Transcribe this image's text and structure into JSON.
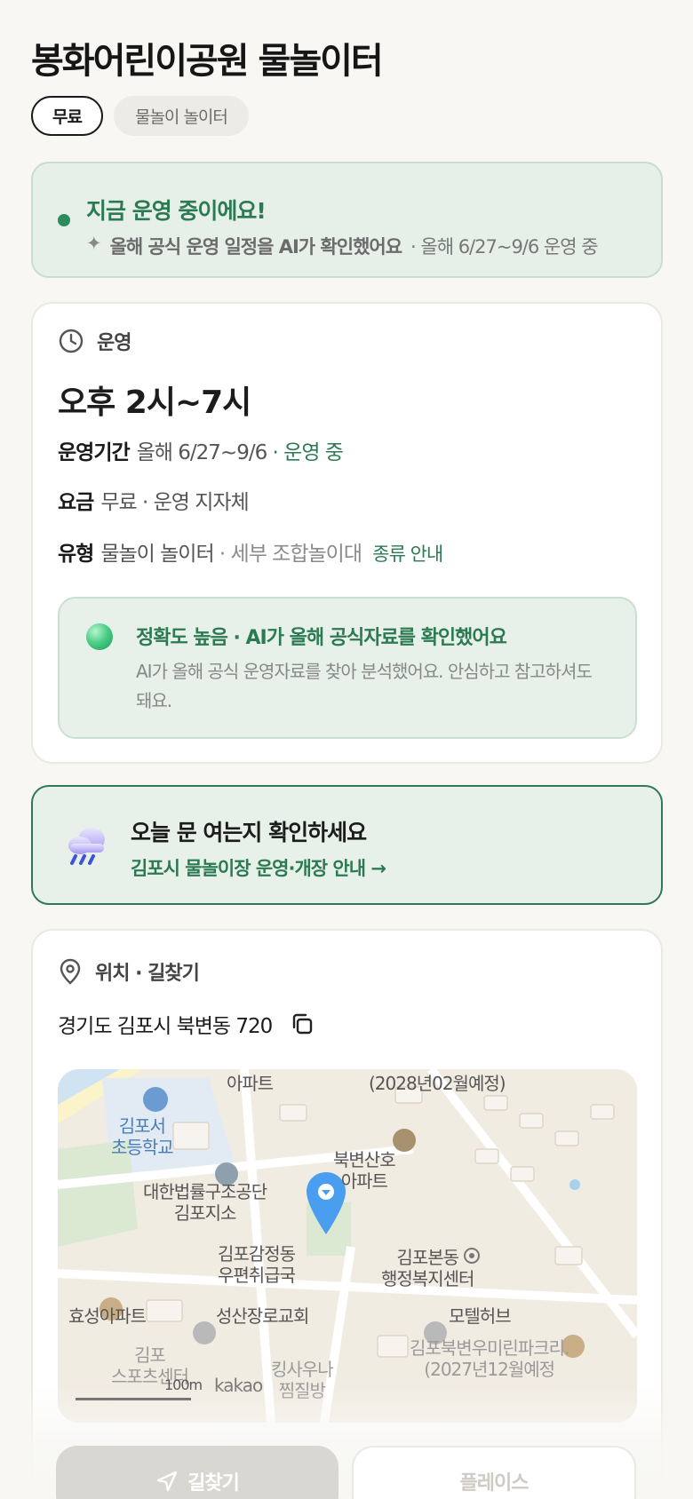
{
  "header": {
    "title": "봉화어린이공원 물놀이터",
    "chips": [
      "무료",
      "물놀이 놀이터"
    ]
  },
  "status": {
    "title": "지금 운영 중이에요!",
    "ai_note": "올해 공식 운영 일정을 AI가 확인했어요",
    "period": "· 올해 6/27~9/6 운영 중"
  },
  "operation": {
    "section_label": "운영",
    "hours": "오후 2시~7시",
    "period_label": "운영기간",
    "period_value": "올해 6/27~9/6",
    "period_status": "· 운영 중",
    "fee_label": "요금",
    "fee_value": "무료 · 운영 지자체",
    "type_label": "유형",
    "type_value": "물놀이 놀이터",
    "type_detail": "· 세부 조합놀이대",
    "type_link": "종류 안내",
    "accuracy": {
      "title": "정확도 높음 · AI가 올해 공식자료를 확인했어요",
      "description": "AI가 올해 공식 운영자료를 찾아 분석했어요. 안심하고 참고하셔도 돼요."
    }
  },
  "notice": {
    "title": "오늘 문 여는지 확인하세요",
    "link": "김포시 물놀이장 운영·개장 안내 →"
  },
  "location": {
    "section_label": "위치 · 길찾기",
    "address": "경기도 김포시 북변동 720",
    "map_labels": {
      "apt_top": "아파트",
      "dev_top": "(2028년02월예정)",
      "school": "김포서\n초등학교",
      "bukbyeon": "북변산호\n아파트",
      "legal": "대한법률구조공단\n김포지소",
      "post": "김포감정동\n우편취급국",
      "welfare": "김포본동\n행정복지센터",
      "hyoseong": "효성아파트",
      "church": "성산장로교회",
      "motel": "모텔허브",
      "riverpark": "김포북변우미린파크리.\n(2027년12월예정",
      "gimpo_bottom": "김포\n스포츠센터",
      "sauna": "킹사우나\n찜질방",
      "scale": "100m",
      "brand": "kakao"
    }
  },
  "actions": {
    "primary": "길찾기",
    "secondary": "플레이스"
  },
  "colors": {
    "accent": "#2b7a51",
    "status_bg": "#e7efe9",
    "pin": "#4a9ef0"
  }
}
